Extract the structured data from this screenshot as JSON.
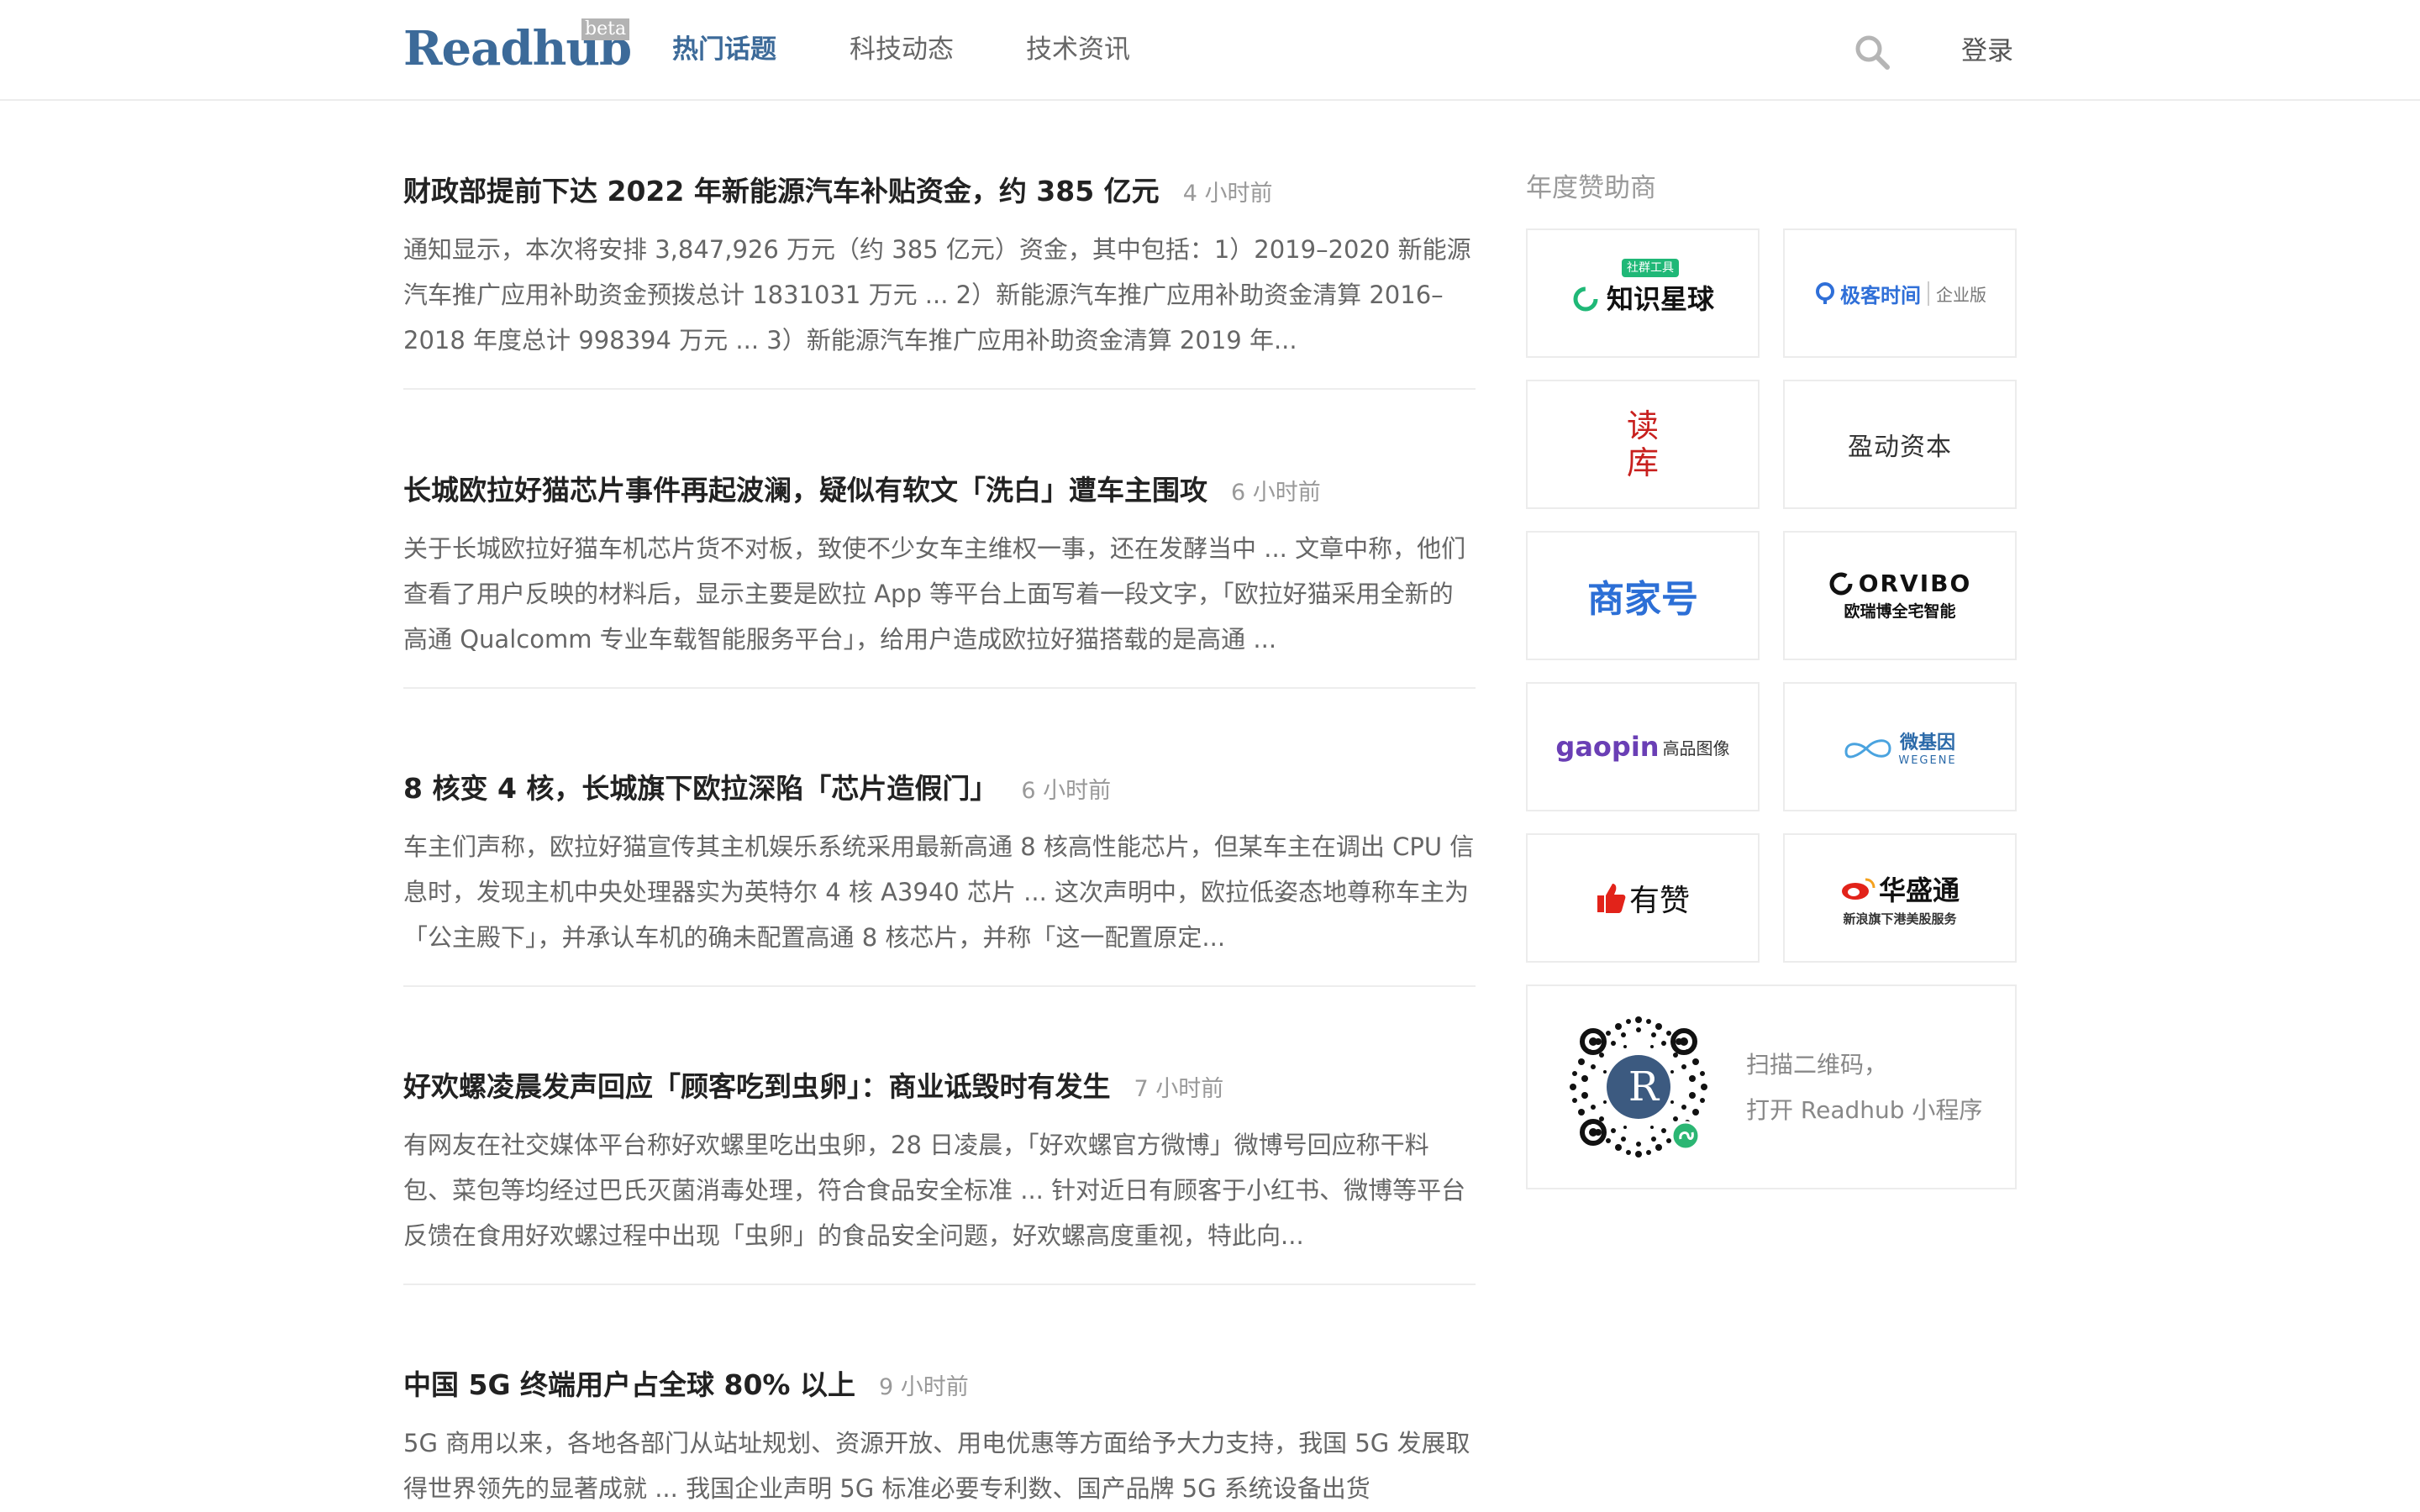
{
  "header": {
    "logo": "Readhub",
    "beta": "beta",
    "nav": [
      {
        "label": "热门话题",
        "active": true
      },
      {
        "label": "科技动态",
        "active": false
      },
      {
        "label": "技术资讯",
        "active": false
      }
    ],
    "search_icon": "search-icon",
    "login": "登录"
  },
  "topics": [
    {
      "title": "财政部提前下达 2022 年新能源汽车补贴资金，约 385 亿元",
      "time": "4 小时前",
      "summary": "通知显示，本次将安排 3,847,926 万元（约 385 亿元）资金，其中包括：1）2019–2020 新能源汽车推广应用补助资金预拨总计 1831031 万元 ... 2）新能源汽车推广应用补助资金清算 2016–2018 年度总计 998394 万元 ... 3）新能源汽车推广应用补助资金清算 2019 年..."
    },
    {
      "title": "长城欧拉好猫芯片事件再起波澜，疑似有软文「洗白」遭车主围攻",
      "time": "6 小时前",
      "summary": "关于长城欧拉好猫车机芯片货不对板，致使不少女车主维权一事，还在发酵当中 ... 文章中称，他们查看了用户反映的材料后，显示主要是欧拉 App 等平台上面写着一段文字，「欧拉好猫采用全新的高通 Qualcomm 专业车载智能服务平台」，给用户造成欧拉好猫搭载的是高通 ..."
    },
    {
      "title": "8 核变 4 核，长城旗下欧拉深陷「芯片造假门」",
      "time": "6 小时前",
      "summary": "车主们声称，欧拉好猫宣传其主机娱乐系统采用最新高通 8 核高性能芯片，但某车主在调出 CPU 信息时，发现主机中央处理器实为英特尔 4 核 A3940 芯片 ... 这次声明中，欧拉低姿态地尊称车主为「公主殿下」，并承认车机的确未配置高通 8 核芯片，并称「这一配置原定..."
    },
    {
      "title": "好欢螺凌晨发声回应「顾客吃到虫卵」：商业诋毁时有发生",
      "time": "7 小时前",
      "summary": "有网友在社交媒体平台称好欢螺里吃出虫卵，28 日凌晨，「好欢螺官方微博」微博号回应称干料包、菜包等均经过巴氏灭菌消毒处理，符合食品安全标准 ... 针对近日有顾客于小红书、微博等平台反馈在食用好欢螺过程中出现「虫卵」的食品安全问题，好欢螺高度重视，特此向..."
    },
    {
      "title": "中国 5G 终端用户占全球 80% 以上",
      "time": "9 小时前",
      "summary": "5G 商用以来，各地各部门从站址规划、资源开放、用电优惠等方面给予大力支持，我国 5G 发展取得世界领先的显著成就 ... 我国企业声明 5G 标准必要专利数、国产品牌 5G 系统设备出货"
    }
  ],
  "sidebar": {
    "sponsor_title": "年度赞助商",
    "sponsors": [
      {
        "name": "知识星球",
        "tag": "社群工具",
        "color": "#1fb877"
      },
      {
        "name": "极客时间",
        "sub": "企业版",
        "color": "#2f6fd8"
      },
      {
        "name": "读库",
        "color": "#c8201e"
      },
      {
        "name": "盈动资本",
        "color": "#333333"
      },
      {
        "name": "商家号",
        "color": "#2c6fd6"
      },
      {
        "name": "ORVIBO",
        "sub": "欧瑞博全宅智能",
        "color": "#111111"
      },
      {
        "name": "gaopin",
        "sub": "高品图像",
        "color": "#6a3fb5"
      },
      {
        "name": "微基因",
        "sub": "WEGENE",
        "color": "#2b6aa9"
      },
      {
        "name": "有赞",
        "color": "#e2231a"
      },
      {
        "name": "华盛通",
        "sub": "新浪旗下港美股服务",
        "color": "#e2231a"
      }
    ],
    "qr": {
      "line1": "扫描二维码，",
      "line2": "打开 Readhub 小程序",
      "center_letter": "R"
    }
  }
}
